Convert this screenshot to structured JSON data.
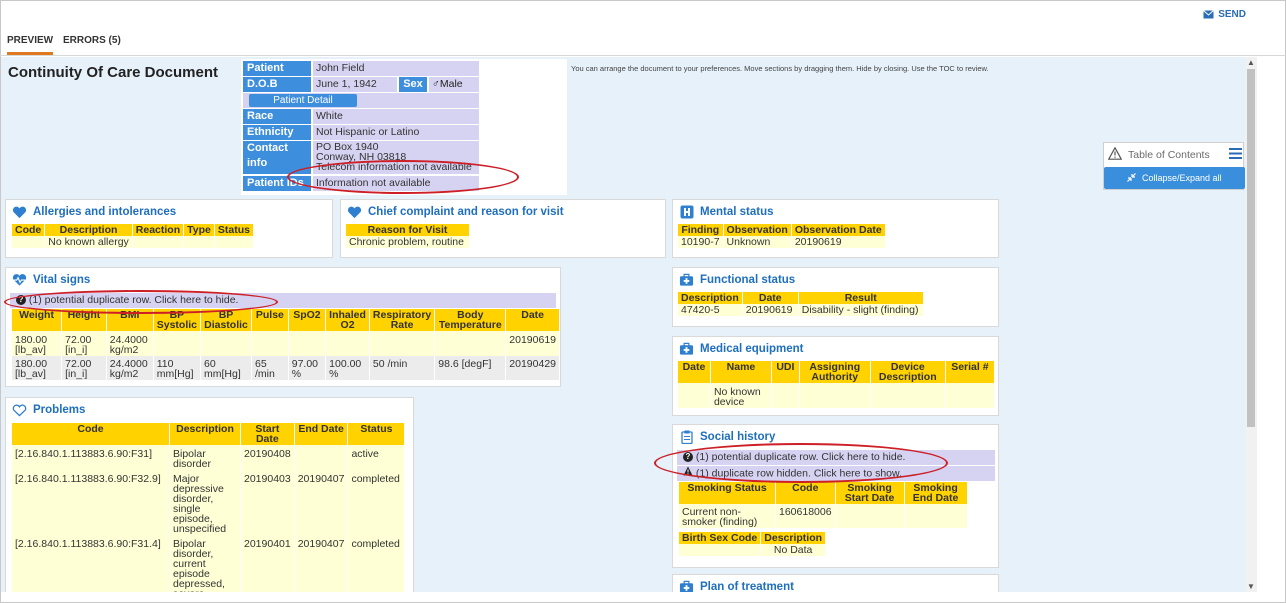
{
  "top": {
    "send_label": "SEND"
  },
  "tabs": [
    {
      "label": "PREVIEW"
    },
    {
      "label": "ERRORS (5)"
    }
  ],
  "doc": {
    "title": "Continuity Of Care Document",
    "hint": "You can arrange the document to your preferences. Move sections by dragging them. Hide by closing. Use the TOC to review."
  },
  "patient": {
    "patient_label": "Patient",
    "patient_value": "John Field",
    "dob_label": "D.O.B",
    "dob_value": "June 1, 1942",
    "sex_label": "Sex",
    "sex_value": "♂Male",
    "detail_button": "Patient Detail",
    "race_label": "Race",
    "race_value": "White",
    "ethnicity_label": "Ethnicity",
    "ethnicity_value": "Not Hispanic or Latino",
    "contact_label": "Contact info",
    "contact_line1": "PO Box 1940",
    "contact_line2": "Conway, NH 03818",
    "contact_line3": "Telecom information not available",
    "patient_id_label": "Patient IDs",
    "patient_id_value": "Information not available"
  },
  "allergies": {
    "title": "Allergies and intolerances",
    "headers": [
      "Code",
      "Description",
      "Reaction",
      "Type",
      "Status"
    ],
    "rows": [
      [
        "",
        "No known allergy",
        "",
        "",
        ""
      ]
    ]
  },
  "chief": {
    "title": "Chief complaint and reason for visit",
    "headers": [
      "Reason for Visit"
    ],
    "rows": [
      [
        "Chronic problem, routine"
      ]
    ]
  },
  "mental": {
    "title": "Mental status",
    "headers": [
      "Finding",
      "Observation",
      "Observation Date"
    ],
    "rows": [
      [
        "10190-7",
        "Unknown",
        "20190619"
      ]
    ]
  },
  "vitals": {
    "title": "Vital signs",
    "dup_message": "(1) potential duplicate row. Click here to hide.",
    "headers": [
      "Weight",
      "Height",
      "BMI",
      "BP Systolic",
      "BP Diastolic",
      "Pulse",
      "SpO2",
      "Inhaled O2",
      "Respiratory Rate",
      "Body Temperature",
      "Date"
    ],
    "rows": [
      [
        "180.00 [lb_av]",
        "72.00 [in_i]",
        "24.4000 kg/m2",
        "",
        "",
        "",
        "",
        "",
        "",
        "",
        "20190619"
      ],
      [
        "180.00 [lb_av]",
        "72.00 [in_i]",
        "24.4000 kg/m2",
        "110 mm[Hg]",
        "60 mm[Hg]",
        "65 /min",
        "97.00 %",
        "100.00 %",
        "50 /min",
        "98.6 [degF]",
        "20190429"
      ]
    ]
  },
  "functional": {
    "title": "Functional status",
    "headers": [
      "Description",
      "Date",
      "Result"
    ],
    "rows": [
      [
        "47420-5",
        "20190619",
        "Disability - slight (finding)"
      ]
    ]
  },
  "equipment": {
    "title": "Medical equipment",
    "headers": [
      "Date",
      "Name",
      "UDI",
      "Assigning Authority",
      "Device Description",
      "Serial #"
    ],
    "rows": [
      [
        "",
        "No known device",
        "",
        "",
        "",
        ""
      ]
    ]
  },
  "problems": {
    "title": "Problems",
    "headers": [
      "Code",
      "Description",
      "Start Date",
      "End Date",
      "Status"
    ],
    "rows": [
      [
        "[2.16.840.1.113883.6.90:F31]",
        "Bipolar disorder",
        "20190408",
        "",
        "active"
      ],
      [
        "[2.16.840.1.113883.6.90:F32.9]",
        "Major depressive disorder, single episode, unspecified",
        "20190403",
        "20190407",
        "completed"
      ],
      [
        "[2.16.840.1.113883.6.90:F31.4]",
        "Bipolar disorder, current episode depressed, severe",
        "20190401",
        "20190407",
        "completed"
      ]
    ]
  },
  "social": {
    "title": "Social history",
    "dup_message": "(1) potential duplicate row. Click here to hide.",
    "hidden_message": "(1) duplicate row hidden. Click here to show.",
    "headers": [
      "Smoking Status",
      "Code",
      "Smoking Start Date",
      "Smoking End Date"
    ],
    "rows": [
      [
        "Current non-smoker (finding)",
        "160618006",
        "",
        ""
      ]
    ],
    "headers2": [
      "Birth Sex Code",
      "Description"
    ],
    "rows2": [
      [
        "",
        "No Data"
      ]
    ]
  },
  "plan": {
    "title": "Plan of treatment"
  },
  "toc": {
    "title": "Table of Contents",
    "button": "Collapse/Expand all"
  },
  "icons": {
    "send": "envelope-icon",
    "allergies": "heart-icon",
    "chief": "heart-icon",
    "mental": "hospital-icon",
    "vitals": "heart-pulse-icon",
    "functional": "medkit-icon",
    "equipment": "medkit-icon",
    "problems": "heart-outline-icon",
    "social": "clipboard-icon",
    "plan": "medkit-icon",
    "toc": "warning-icon",
    "toc_menu": "hamburger-icon",
    "collapse": "collapse-icon"
  },
  "colors": {
    "accent": "#3e8ede",
    "header_cell": "#ffd200",
    "data_cell": "#ffffd6",
    "label_cell": "#d6d2f1",
    "title": "#1f6fbf",
    "highlight": "#cc1f26"
  }
}
